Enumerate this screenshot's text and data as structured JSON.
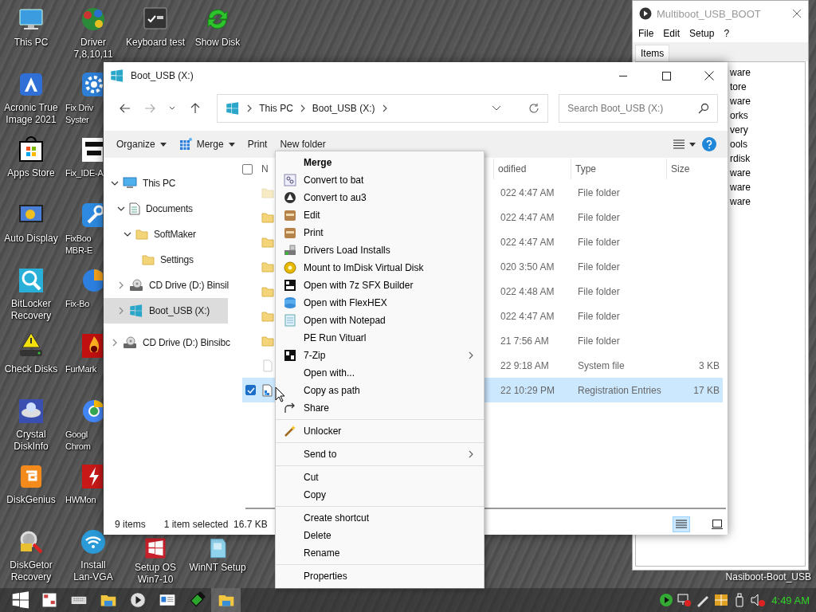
{
  "desktop_icons": [
    {
      "label": "This PC"
    },
    {
      "label": "Acronic True\nImage 2021"
    },
    {
      "label": "Apps Store"
    },
    {
      "label": "Auto Display"
    },
    {
      "label": "BitLocker\nRecovery"
    },
    {
      "label": "Check Disks"
    },
    {
      "label": "Crystal\nDiskInfo"
    },
    {
      "label": "DiskGenius"
    },
    {
      "label": "DiskGetor\nRecovery"
    },
    {
      "label": "Driver\n7,8,10,11"
    },
    {
      "label": "Fix Driv\nSyster"
    },
    {
      "label": "Fix_IDE-A"
    },
    {
      "label": "FixBoo\nMBR-E"
    },
    {
      "label": "Fix-Bo"
    },
    {
      "label": "FurMark"
    },
    {
      "label": "Googl\nChrom"
    },
    {
      "label": "HWMon"
    },
    {
      "label": "Install\nLan-VGA"
    },
    {
      "label": "Keyboard test"
    },
    {
      "label": "Setup OS\nWin7-10"
    },
    {
      "label": "Show Disk"
    },
    {
      "label": "WinNT Setup"
    }
  ],
  "desktop_text": "Nasiboot-Boot_USB",
  "multiboot": {
    "title": "Multiboot_USB_BOOT",
    "menu": [
      "File",
      "Edit",
      "Setup",
      "?"
    ],
    "tabs": [
      {
        "label": "Items",
        "selected": true
      }
    ],
    "items": [
      "ware",
      "tore",
      "ware",
      "orks",
      "very",
      "ools",
      "rdisk",
      "ware",
      "ware",
      "ware"
    ]
  },
  "explorer": {
    "title": "Boot_USB (X:)",
    "breadcrumb": [
      "This PC",
      "Boot_USB (X:)"
    ],
    "search": {
      "placeholder": "Search Boot_USB (X:)"
    },
    "toolbar": [
      {
        "label": "Organize",
        "dropdown": true
      },
      {
        "label": "Merge",
        "dropdown": true
      },
      {
        "label": "Print",
        "dropdown": false
      },
      {
        "label": "New folder",
        "dropdown": false
      }
    ],
    "tree": [
      {
        "label": "This PC",
        "kind": "pc",
        "expanded": true,
        "selected": false,
        "children": [
          {
            "label": "Documents",
            "kind": "documents",
            "expanded": true,
            "selected": false,
            "children": [
              {
                "label": "SoftMaker",
                "kind": "folder",
                "expanded": true,
                "selected": false,
                "children": [
                  {
                    "label": "Settings",
                    "kind": "folder",
                    "selected": false
                  }
                ]
              }
            ]
          },
          {
            "label": "CD Drive (D:) Binsil",
            "kind": "cd",
            "expanded": false,
            "selected": false
          },
          {
            "label": "Boot_USB (X:)",
            "kind": "usb",
            "expanded": false,
            "selected": true
          }
        ]
      },
      {
        "label": "CD Drive (D:) Binsibc",
        "kind": "cd",
        "expanded": false,
        "selected": false
      }
    ],
    "select_all": {
      "checked": false
    },
    "columns": [
      "N",
      "odified",
      "Type",
      "Size"
    ],
    "rows": [
      {
        "kind": "folder",
        "hidden": true,
        "date": "022 4:47 AM",
        "type": "File folder",
        "selected": false
      },
      {
        "kind": "folder",
        "hidden": false,
        "date": "022 4:47 AM",
        "type": "File folder",
        "selected": false
      },
      {
        "kind": "folder",
        "hidden": false,
        "date": "022 4:47 AM",
        "type": "File folder",
        "selected": false
      },
      {
        "kind": "folder",
        "hidden": false,
        "date": "020 3:50 AM",
        "type": "File folder",
        "selected": false
      },
      {
        "kind": "folder",
        "hidden": false,
        "date": "022 4:48 AM",
        "type": "File folder",
        "selected": false
      },
      {
        "kind": "folder",
        "hidden": false,
        "date": "022 4:47 AM",
        "type": "File folder",
        "selected": false
      },
      {
        "kind": "folder",
        "hidden": false,
        "date": "21 7:56 AM",
        "type": "File folder",
        "selected": false
      },
      {
        "kind": "file",
        "hidden": true,
        "date": "22 9:18 AM",
        "type": "System file",
        "size": "3 KB",
        "selected": false
      },
      {
        "kind": "registry",
        "hidden": false,
        "date": "22 10:29 PM",
        "type": "Registration Entries",
        "size": "17 KB",
        "selected": true
      }
    ],
    "status": {
      "count": "9 items",
      "selection": "1 item selected",
      "size": "16.7 KB"
    },
    "view": [
      {
        "kind": "details",
        "selected": true
      },
      {
        "kind": "tiles",
        "selected": false
      }
    ]
  },
  "context_menu": [
    {
      "kind": "item",
      "label": "Merge",
      "default": true,
      "submenu": false
    },
    {
      "kind": "item",
      "label": "Convert to bat",
      "default": false,
      "submenu": false
    },
    {
      "kind": "item",
      "label": "Convert to au3",
      "default": false,
      "submenu": false
    },
    {
      "kind": "item",
      "label": "Edit",
      "default": false,
      "submenu": false
    },
    {
      "kind": "item",
      "label": "Print",
      "default": false,
      "submenu": false
    },
    {
      "kind": "item",
      "label": "Drivers Load Installs",
      "default": false,
      "submenu": false
    },
    {
      "kind": "item",
      "label": "Mount to ImDisk Virtual Disk",
      "default": false,
      "submenu": false
    },
    {
      "kind": "item",
      "label": "Open with 7z SFX Builder",
      "default": false,
      "submenu": false
    },
    {
      "kind": "item",
      "label": "Open with FlexHEX",
      "default": false,
      "submenu": false
    },
    {
      "kind": "item",
      "label": "Open with Notepad",
      "default": false,
      "submenu": false
    },
    {
      "kind": "item",
      "label": "PE Run Vituarl",
      "default": false,
      "submenu": false
    },
    {
      "kind": "item",
      "label": "7-Zip",
      "default": false,
      "submenu": true
    },
    {
      "kind": "item",
      "label": "Open with...",
      "default": false,
      "submenu": false
    },
    {
      "kind": "item",
      "label": "Copy as path",
      "default": false,
      "submenu": false
    },
    {
      "kind": "item",
      "label": "Share",
      "default": false,
      "submenu": false
    },
    {
      "kind": "separator"
    },
    {
      "kind": "item",
      "label": "Unlocker",
      "default": false,
      "submenu": false
    },
    {
      "kind": "separator"
    },
    {
      "kind": "item",
      "label": "Send to",
      "default": false,
      "submenu": true
    },
    {
      "kind": "separator"
    },
    {
      "kind": "item",
      "label": "Cut",
      "default": false,
      "submenu": false
    },
    {
      "kind": "item",
      "label": "Copy",
      "default": false,
      "submenu": false
    },
    {
      "kind": "separator"
    },
    {
      "kind": "item",
      "label": "Create shortcut",
      "default": false,
      "submenu": false
    },
    {
      "kind": "item",
      "label": "Delete",
      "default": false,
      "submenu": false
    },
    {
      "kind": "item",
      "label": "Rename",
      "default": false,
      "submenu": false
    },
    {
      "kind": "separator"
    },
    {
      "kind": "item",
      "label": "Properties",
      "default": false,
      "submenu": false
    }
  ],
  "taskbar": {
    "clock": "4:49 AM"
  }
}
